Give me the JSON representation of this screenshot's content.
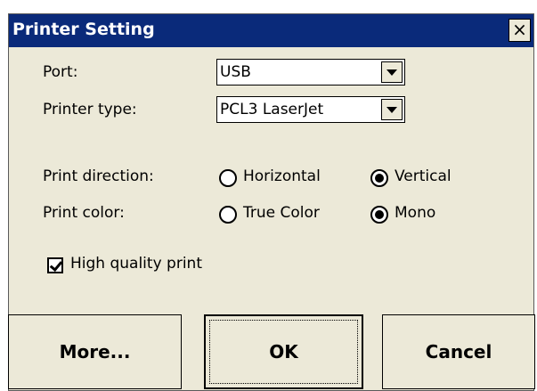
{
  "window": {
    "title": "Printer Setting",
    "close_label": "×"
  },
  "port": {
    "label": "Port:",
    "value": "USB"
  },
  "printer_type": {
    "label": "Printer type:",
    "value": "PCL3 LaserJet"
  },
  "print_direction": {
    "label": "Print direction:",
    "options": [
      "Horizontal",
      "Vertical"
    ],
    "selected": "Vertical"
  },
  "print_color": {
    "label": "Print color:",
    "options": [
      "True Color",
      "Mono"
    ],
    "selected": "Mono"
  },
  "high_quality": {
    "label": "High quality print",
    "checked": true
  },
  "buttons": {
    "more": "More...",
    "ok": "OK",
    "cancel": "Cancel"
  },
  "colors": {
    "titlebar": "#0a2a7a",
    "dialog_bg": "#ece9d8"
  }
}
